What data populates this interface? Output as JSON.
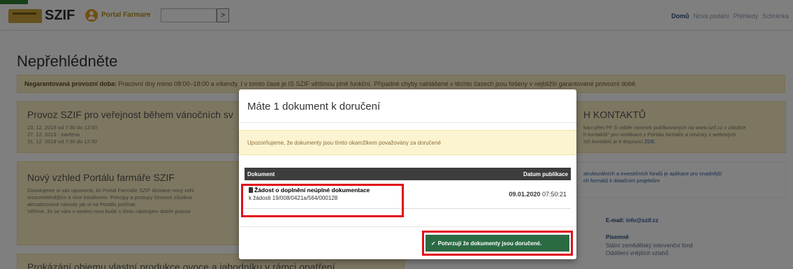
{
  "header": {
    "logo_text": "SZIF",
    "portal_label": "Portal Farmare",
    "search_value": "",
    "search_button": ">",
    "nav": [
      "Domů",
      "Nová podání",
      "Přehledy",
      "Schránka"
    ]
  },
  "page": {
    "title": "Nepřehlédněte",
    "warning_bold": "Negarantovaná provozní doba:",
    "warning_text": " Pracovní dny mimo 08:00–18:00 a víkendy. I v tomto čase je IS SZIF většinou plně funkční. Případné chyby nahlášené v těchto časech jsou řešeny v nejbližší garantované provozní době.",
    "card1": {
      "title": "Provoz SZIF pro veřejnost během vánočních sv",
      "lines": [
        "23. 12. 2019 od 7:30 do 12:00",
        "27. 12. 2019 - zavřeno",
        "31. 12. 2019 od 7:30 do 12:00"
      ]
    },
    "card2": {
      "title": "Nový vzhled Portálu farmáře SZIF",
      "lines": [
        "Dovolujeme si vás upozornit, že Portál Farmáře SZIF dostane nový vzhl",
        "srozumitelnějším a více intuitivním. Principy a postupy činností zůstáva",
        "aktualizované návody jak si na Portálu počínat.",
        "",
        "Věříme, že se vám v novém roce bude s tímto nástrojem dobře pracov"
      ]
    },
    "card3": {
      "title": "Prokázání objemu vlastní produkce ovoce a jahodníku v rámci opatření"
    },
    "right1": {
      "title": "H KONTAKTŮ",
      "lines": [
        "kaci přes PF či odběr novinek publikovaných na www.szif.cz v záložce",
        "h kontaktů“ pro notifikace z Portálu farmáře a novinky z webových",
        "ích kontaktů je k dispozici"
      ],
      "link": "ZDE."
    },
    "right2": {
      "lines": [
        "strukturálních a investičních fondů je aplikace pro snadnější",
        "ch formátů k dotačním projektům"
      ]
    },
    "contact": {
      "email_label": "E-mail:",
      "email": "info@szif.cz",
      "written_label": "Písemně",
      "written_lines": [
        "Státní zemědělský intervenční fond",
        "Oddělení vnějších vztahů"
      ]
    }
  },
  "modal": {
    "title": "Máte 1 dokument k doručení",
    "alert": "Upozorňujeme, že dokumenty jsou tímto okamžikem považovány za doručené",
    "col_document": "Dokument",
    "col_date": "Datum publikace",
    "rows": [
      {
        "title": "Žádost o doplnění neúplné dokumentace",
        "subtitle": "k žádosti 19/008/0421a/564/000128",
        "date": "09.01.2020",
        "time": "07:50:21"
      }
    ],
    "confirm_label": "Potvrzuji že dokumenty jsou doručené."
  },
  "colors": {
    "warning_bg": "#fbeec3",
    "confirm_bg": "#2b6b44",
    "highlight": "#e0101a"
  }
}
